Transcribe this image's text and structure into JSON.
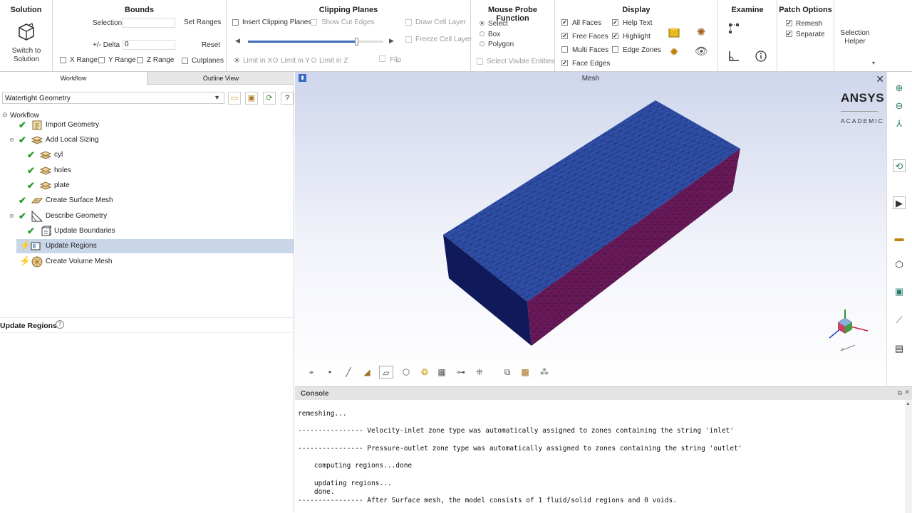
{
  "ribbon": {
    "solution": {
      "title": "Solution",
      "switch_label_1": "Switch to",
      "switch_label_2": "Solution"
    },
    "bounds": {
      "title": "Bounds",
      "selection_label": "Selection",
      "set_ranges": "Set Ranges",
      "delta_label": "+/- Delta",
      "delta_value": "0",
      "reset": "Reset",
      "x_range": "X Range",
      "y_range": "Y Range",
      "z_range": "Z Range",
      "cutplanes": "Cutplanes"
    },
    "clipping": {
      "title": "Clipping Planes",
      "insert": "Insert Clipping Planes",
      "show_cut_edges": "Show Cut Edges",
      "draw_cell_layer": "Draw Cell Layer",
      "freeze_cell_layer": "Freeze Cell Layer",
      "limit_x": "Limit in X",
      "limit_y": "Limit in Y",
      "limit_z": "Limit in Z",
      "flip": "Flip",
      "slider_value": 0.8
    },
    "probe": {
      "title": "Mouse Probe Function",
      "select": "Select",
      "box": "Box",
      "polygon": "Polygon",
      "show_visible": "Select Visible Entities"
    },
    "display": {
      "title": "Display",
      "all_faces": "All Faces",
      "free_faces": "Free Faces",
      "multi_faces": "Multi Faces",
      "face_edges": "Face Edges",
      "help_text": "Help Text",
      "highlight": "Highlight",
      "edge_zones": "Edge Zones"
    },
    "examine": {
      "title": "Examine"
    },
    "patch": {
      "title": "Patch Options",
      "remesh": "Remesh",
      "separate": "Separate"
    },
    "selection_helper": {
      "line1": "Selection",
      "line2": "Helper"
    }
  },
  "left": {
    "tabs": [
      "Workflow",
      "Outline View"
    ],
    "dropdown": "Watertight Geometry",
    "tree_root": "Workflow",
    "tree": [
      {
        "label": "Import Geometry"
      },
      {
        "label": "Add Local Sizing"
      },
      {
        "label": "cyl"
      },
      {
        "label": "holes"
      },
      {
        "label": "plate"
      },
      {
        "label": "Create Surface Mesh"
      },
      {
        "label": "Describe Geometry"
      },
      {
        "label": "Update Boundaries"
      },
      {
        "label": "Update Regions"
      },
      {
        "label": "Create Volume Mesh"
      }
    ],
    "task_title": "Update Regions"
  },
  "viewport": {
    "title": "Mesh",
    "brand": "ANSYS",
    "brand_sub": "ACADEMIC"
  },
  "console": {
    "title": "Console",
    "lines": [
      "remeshing...",
      "---------------- Velocity-inlet zone type was automatically assigned to zones containing the string 'inlet'",
      "---------------- Pressure-outlet zone type was automatically assigned to zones containing the string 'outlet'",
      "    computing regions...done",
      "    updating regions...",
      "    done.",
      "---------------- After Surface mesh, the model consists of 1 fluid/solid regions and 0 voids."
    ]
  },
  "colors": {
    "accent_check": "#2a9a2a",
    "mesh_top": "#2f4fa8",
    "mesh_side": "#6a1a5a",
    "selected_row": "#c9d6e8"
  }
}
